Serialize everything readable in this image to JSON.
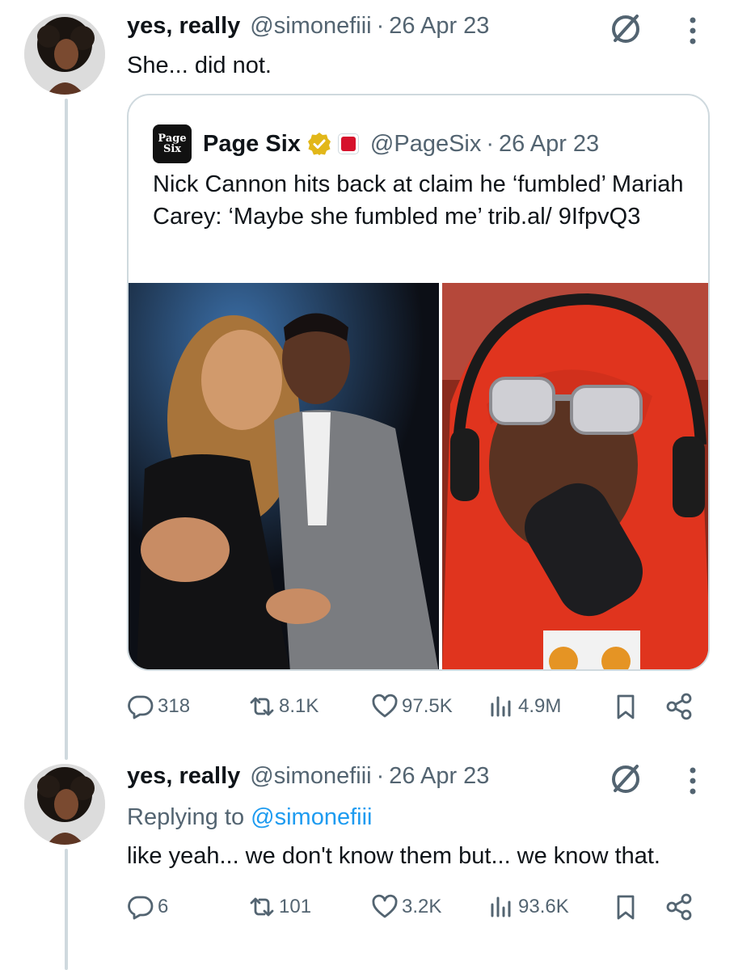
{
  "tweet1": {
    "name": "yes, really",
    "handle": "@simonefiii",
    "separator": "·",
    "date": "26 Apr 23",
    "text": "She... did not.",
    "quote": {
      "logo_line1": "Page",
      "logo_line2": "Six",
      "name": "Page Six",
      "handle": "@PageSix",
      "separator": "·",
      "date": "26 Apr 23",
      "text": "Nick Cannon hits back at claim he ‘fumbled’ Mariah Carey: ‘Maybe she fumbled me’ trib.al/ 9IfpvQ3"
    },
    "actions": {
      "replies": "318",
      "reposts": "8.1K",
      "likes": "97.5K",
      "views": "4.9M"
    }
  },
  "tweet2": {
    "name": "yes, really",
    "handle": "@simonefiii",
    "separator": "·",
    "date": "26 Apr 23",
    "replying_label": "Replying to",
    "replying_handle": "@simonefiii",
    "text": "like yeah... we don't know them but... we know that.",
    "actions": {
      "replies": "6",
      "reposts": "101",
      "likes": "3.2K",
      "views": "93.6K"
    }
  },
  "icons": {
    "reply": "reply-icon",
    "repost": "repost-icon",
    "like": "heart-icon",
    "views": "views-icon",
    "bookmark": "bookmark-icon",
    "share": "share-icon",
    "grok": "grok-icon",
    "more": "more-icon",
    "verified": "verified-badge-icon"
  },
  "colors": {
    "text": "#0f1419",
    "secondary": "#536471",
    "link": "#1d9bf0",
    "border": "#cfd9de",
    "verified_gold": "#e2b719"
  }
}
